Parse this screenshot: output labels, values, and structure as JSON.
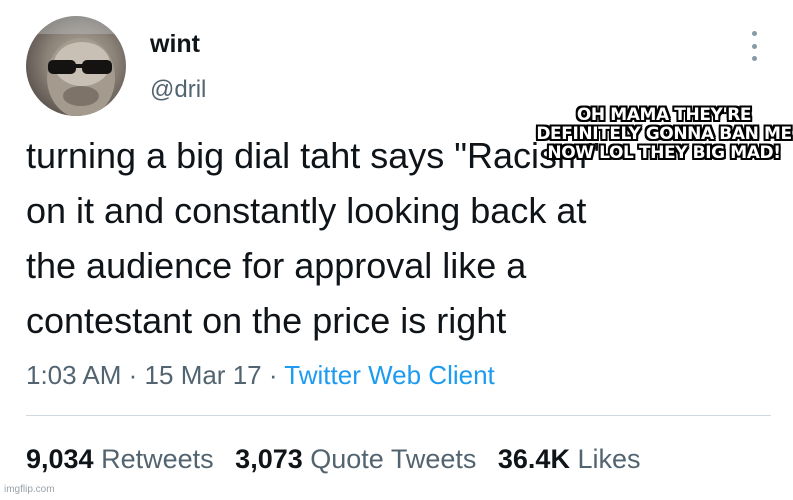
{
  "tweet": {
    "display_name": "wint",
    "handle": "@dril",
    "text_lines": [
      "turning a big dial taht says \"Racism\"",
      "on it and constantly looking back at",
      "the audience for approval like a",
      "contestant on the price is right"
    ],
    "time": "1:03 AM",
    "date": "15 Mar 17",
    "separator": "·",
    "source": "Twitter Web Client",
    "more_icon": "more-dots-icon"
  },
  "stats": {
    "retweets_count": "9,034",
    "retweets_label": "Retweets",
    "quotes_count": "3,073",
    "quotes_label": "Quote Tweets",
    "likes_count": "36.4K",
    "likes_label": "Likes"
  },
  "caption": {
    "text": "OH MAMA THEY'RE DEFINITELY GONNA BAN ME NOW LOL THEY BIG MAD!"
  },
  "watermark": "imgflip.com",
  "colors": {
    "text": "#0f1419",
    "secondary": "#536471",
    "link": "#1d9bf0",
    "divider": "#cfd9de"
  }
}
